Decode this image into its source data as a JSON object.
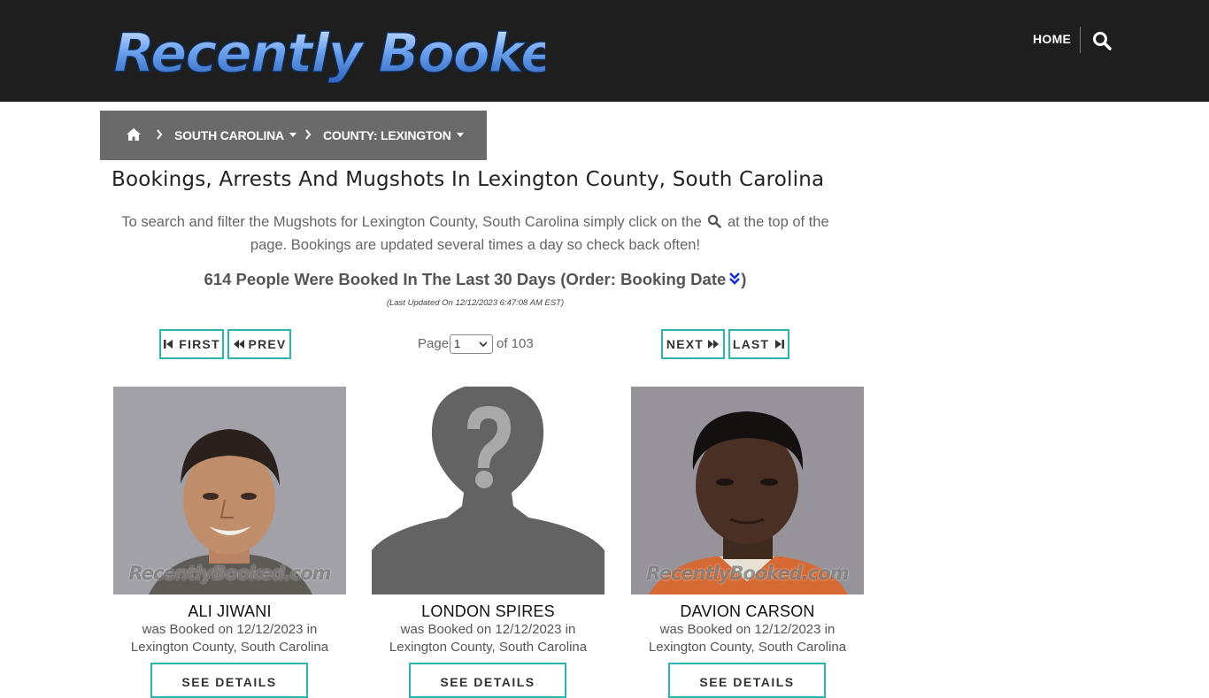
{
  "header": {
    "logo_text": "Recently Booked",
    "nav_home": "HOME",
    "search_icon": "search-icon"
  },
  "breadcrumb": {
    "home_icon": "home-icon",
    "items": [
      {
        "label": "SOUTH CAROLINA"
      },
      {
        "label": "COUNTY: LEXINGTON"
      }
    ]
  },
  "page": {
    "title": "Bookings, Arrests And Mugshots In Lexington County, South Carolina",
    "intro_before": "To search and filter the Mugshots for Lexington County, South Carolina simply click on the",
    "intro_after": "at the top of the page. Bookings are updated several times a day so check back often!",
    "count_before": "614 People Were Booked In The Last 30 Days (Order: Booking Date",
    "count_after": ")",
    "last_updated": "(Last Updated On 12/12/2023 6:47:08 AM EST)"
  },
  "pagination": {
    "first": "FIRST",
    "prev": "PREV",
    "next": "NEXT",
    "last": "LAST",
    "page_label": "Page",
    "current_page": "1",
    "of_label": "of 103"
  },
  "cards": [
    {
      "name": "Ali Jiwani",
      "desc_line1": "was Booked on 12/12/2023 in",
      "desc_line2": "Lexington County, South Carolina",
      "watermark": "RecentlyBooked.com",
      "button": "SEE DETAILS"
    },
    {
      "name": "London Spires",
      "desc_line1": "was Booked on 12/12/2023 in",
      "desc_line2": "Lexington County, South Carolina",
      "watermark": "",
      "button": "SEE DETAILS"
    },
    {
      "name": "Davion Carson",
      "desc_line1": "was Booked on 12/12/2023 in",
      "desc_line2": "Lexington County, South Carolina",
      "watermark": "RecentlyBooked.com",
      "button": "SEE DETAILS"
    }
  ],
  "colors": {
    "header_bg": "#1e1e1e",
    "breadcrumb_bg": "#6a6a6a",
    "accent_teal": "#2bb5ac",
    "order_icon_blue": "#1a2fd6"
  }
}
